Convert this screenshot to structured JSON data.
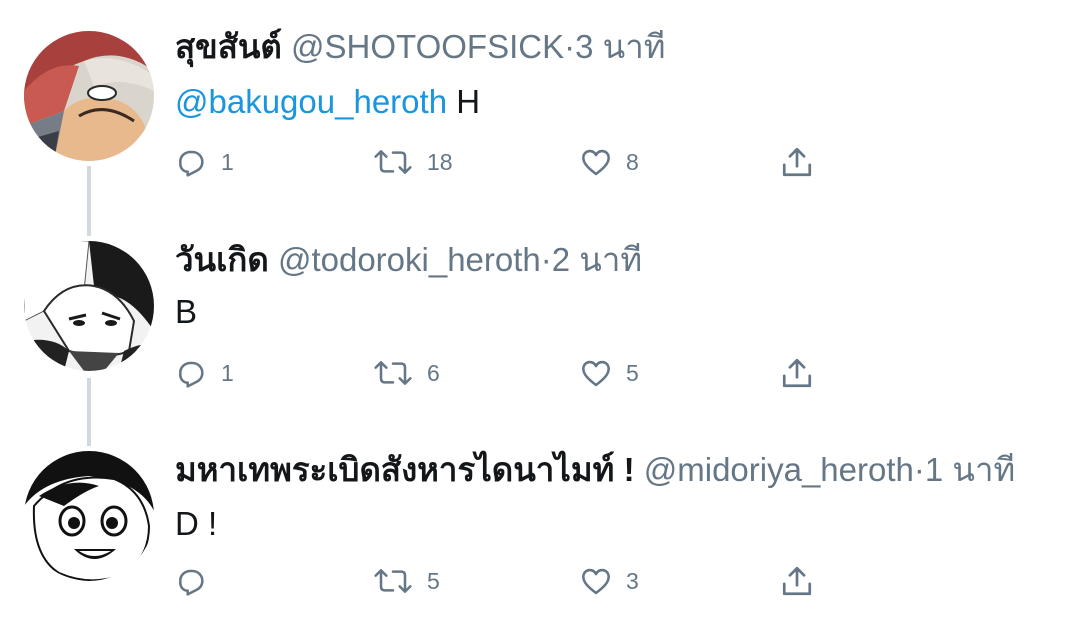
{
  "tweets": [
    {
      "name": "สุขสันต์",
      "handle": "@SHOTOOFSICK",
      "dot": "·",
      "time": "3 นาที",
      "mention": "@bakugou_heroth",
      "text": "H",
      "reply_count": "1",
      "retweet_count": "18",
      "like_count": "8"
    },
    {
      "name": "วันเกิด",
      "handle": "@todoroki_heroth",
      "dot": "·",
      "time": "2 นาที",
      "text": "B",
      "reply_count": "1",
      "retweet_count": "6",
      "like_count": "5"
    },
    {
      "name": "มหาเทพระเบิดสังหารไดนาไมท์ !",
      "handle": "@midoriya_heroth",
      "dot": "·",
      "time": "1 นาที",
      "text": "D !",
      "reply_count": "",
      "retweet_count": "5",
      "like_count": "3"
    }
  ],
  "icons": {
    "reply": "reply-icon",
    "retweet": "retweet-icon",
    "like": "heart-icon",
    "share": "share-icon"
  },
  "colors": {
    "mention": "#1b95e0",
    "secondary_text": "#657786",
    "thread_line": "#cfd9de"
  }
}
